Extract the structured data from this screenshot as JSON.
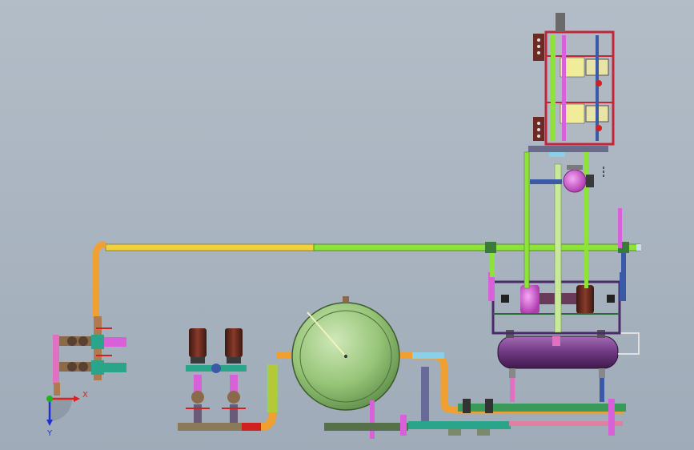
{
  "viewport": {
    "background_top": "#b3bdc8",
    "background_bottom": "#9fabb8"
  },
  "triad": {
    "x_label": "X",
    "y_label": "Y",
    "x_color": "#e02020",
    "y_color": "#2030d0",
    "origin_color": "#20b020"
  },
  "components": [
    {
      "id": "upper-pipe",
      "kind": "pipe"
    },
    {
      "id": "valve-manifold-left",
      "kind": "valve-group"
    },
    {
      "id": "pump-pair",
      "kind": "pump",
      "count": 2
    },
    {
      "id": "spherical-tank",
      "kind": "vessel"
    },
    {
      "id": "horizontal-tank",
      "kind": "vessel"
    },
    {
      "id": "control-frame",
      "kind": "frame"
    },
    {
      "id": "small-pump",
      "kind": "pump",
      "count": 1
    }
  ],
  "colors": {
    "yellow_pipe": "#f2d23a",
    "green_pipe": "#8ee33a",
    "orange_pipe": "#f0a030",
    "tank_green": "#a6cf86",
    "tank_purple": "#7a3f8c",
    "frame_red": "#c0283a",
    "magenta": "#d860d8",
    "teal": "#2aa58a",
    "dark_green_pipe": "#56704a",
    "motor_brown": "#6b2a22"
  }
}
